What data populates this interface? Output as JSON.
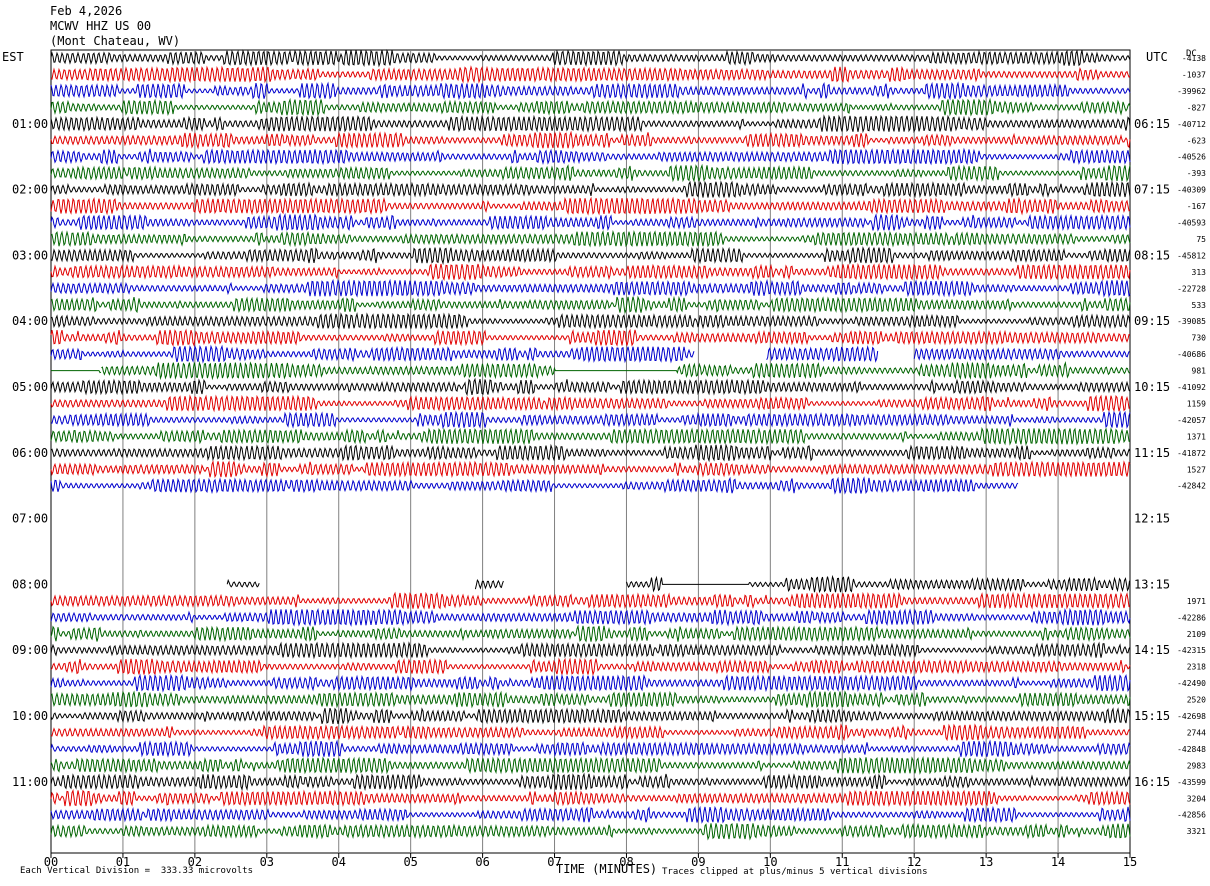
{
  "header": {
    "date": "Feb 4,2026",
    "station": "MCWV HHZ US 00",
    "location": "(Mont Chateau, WV)"
  },
  "left_axis_title": "EST",
  "right_axis_title": "UTC",
  "right_column_title": "DC",
  "footer": {
    "scale_note": "Each Vertical Division =  333.33 microvolts",
    "clip_note": "Traces clipped at plus/minus 5 vertical divisions",
    "x_axis_title": "TIME (MINUTES)"
  },
  "colors": {
    "black": "#000000",
    "red": "#e00000",
    "blue": "#0000cc",
    "green": "#006400",
    "grid": "#808080"
  },
  "chart_data": {
    "type": "line",
    "title": "MCWV HHZ US 00",
    "xlabel": "TIME (MINUTES)",
    "xlim": [
      0,
      15
    ],
    "x_ticks": [
      "00",
      "01",
      "02",
      "03",
      "04",
      "05",
      "06",
      "07",
      "08",
      "09",
      "10",
      "11",
      "12",
      "13",
      "14",
      "15"
    ],
    "grid": true,
    "trace_color_cycle": [
      "black",
      "red",
      "blue",
      "green"
    ],
    "left_hour_labels": [
      {
        "row": 4,
        "text": "01:00"
      },
      {
        "row": 8,
        "text": "02:00"
      },
      {
        "row": 12,
        "text": "03:00"
      },
      {
        "row": 16,
        "text": "04:00"
      },
      {
        "row": 20,
        "text": "05:00"
      },
      {
        "row": 24,
        "text": "06:00"
      },
      {
        "row": 28,
        "text": "07:00"
      },
      {
        "row": 32,
        "text": "08:00"
      },
      {
        "row": 36,
        "text": "09:00"
      },
      {
        "row": 40,
        "text": "10:00"
      },
      {
        "row": 44,
        "text": "11:00"
      }
    ],
    "right_hour_labels": [
      {
        "row": 4,
        "text": "06:15"
      },
      {
        "row": 8,
        "text": "07:15"
      },
      {
        "row": 12,
        "text": "08:15"
      },
      {
        "row": 16,
        "text": "09:15"
      },
      {
        "row": 20,
        "text": "10:15"
      },
      {
        "row": 24,
        "text": "11:15"
      },
      {
        "row": 28,
        "text": "12:15"
      },
      {
        "row": 32,
        "text": "13:15"
      },
      {
        "row": 36,
        "text": "14:15"
      },
      {
        "row": 40,
        "text": "15:15"
      },
      {
        "row": 44,
        "text": "16:15"
      }
    ],
    "dc_offsets": [
      {
        "row": 0,
        "text": "-4138"
      },
      {
        "row": 1,
        "text": "-1037"
      },
      {
        "row": 2,
        "text": "-39962"
      },
      {
        "row": 3,
        "text": "-827"
      },
      {
        "row": 4,
        "text": "-40712"
      },
      {
        "row": 5,
        "text": "-623"
      },
      {
        "row": 6,
        "text": "-40526"
      },
      {
        "row": 7,
        "text": "-393"
      },
      {
        "row": 8,
        "text": "-40309"
      },
      {
        "row": 9,
        "text": "-167"
      },
      {
        "row": 10,
        "text": "-40593"
      },
      {
        "row": 11,
        "text": "75"
      },
      {
        "row": 12,
        "text": "-45812"
      },
      {
        "row": 13,
        "text": "313"
      },
      {
        "row": 14,
        "text": "-22728"
      },
      {
        "row": 15,
        "text": "533"
      },
      {
        "row": 16,
        "text": "-39085"
      },
      {
        "row": 17,
        "text": "730"
      },
      {
        "row": 18,
        "text": "-40686"
      },
      {
        "row": 19,
        "text": "981"
      },
      {
        "row": 20,
        "text": "-41092"
      },
      {
        "row": 21,
        "text": "1159"
      },
      {
        "row": 22,
        "text": "-42057"
      },
      {
        "row": 23,
        "text": "1371"
      },
      {
        "row": 24,
        "text": "-41872"
      },
      {
        "row": 25,
        "text": "1527"
      },
      {
        "row": 26,
        "text": "-42842"
      },
      {
        "row": 33,
        "text": "1971"
      },
      {
        "row": 34,
        "text": "-42286"
      },
      {
        "row": 35,
        "text": "2109"
      },
      {
        "row": 36,
        "text": "-42315"
      },
      {
        "row": 37,
        "text": "2318"
      },
      {
        "row": 38,
        "text": "-42490"
      },
      {
        "row": 39,
        "text": "2520"
      },
      {
        "row": 40,
        "text": "-42698"
      },
      {
        "row": 41,
        "text": "2744"
      },
      {
        "row": 42,
        "text": "-42848"
      },
      {
        "row": 43,
        "text": "2983"
      },
      {
        "row": 44,
        "text": "-43599"
      },
      {
        "row": 45,
        "text": "3204"
      },
      {
        "row": 46,
        "text": "-42856"
      },
      {
        "row": 47,
        "text": "3321"
      }
    ],
    "row_count": 48,
    "data_rows": [
      {
        "row": 0,
        "segments": [
          [
            0,
            15
          ]
        ]
      },
      {
        "row": 1,
        "segments": [
          [
            0,
            15
          ]
        ]
      },
      {
        "row": 2,
        "segments": [
          [
            0,
            15
          ]
        ]
      },
      {
        "row": 3,
        "segments": [
          [
            0,
            15
          ]
        ]
      },
      {
        "row": 4,
        "segments": [
          [
            0,
            15
          ]
        ]
      },
      {
        "row": 5,
        "segments": [
          [
            0,
            15
          ]
        ]
      },
      {
        "row": 6,
        "segments": [
          [
            0,
            15
          ]
        ]
      },
      {
        "row": 7,
        "segments": [
          [
            0,
            15
          ]
        ]
      },
      {
        "row": 8,
        "segments": [
          [
            0,
            15
          ]
        ]
      },
      {
        "row": 9,
        "segments": [
          [
            0,
            15
          ]
        ]
      },
      {
        "row": 10,
        "segments": [
          [
            0,
            15
          ]
        ]
      },
      {
        "row": 11,
        "segments": [
          [
            0,
            15
          ]
        ]
      },
      {
        "row": 12,
        "segments": [
          [
            0,
            15
          ]
        ]
      },
      {
        "row": 13,
        "segments": [
          [
            0,
            15
          ]
        ]
      },
      {
        "row": 14,
        "segments": [
          [
            0,
            15
          ]
        ]
      },
      {
        "row": 15,
        "segments": [
          [
            0,
            15
          ]
        ]
      },
      {
        "row": 16,
        "segments": [
          [
            0,
            15
          ]
        ]
      },
      {
        "row": 17,
        "segments": [
          [
            0,
            15
          ]
        ]
      },
      {
        "row": 18,
        "segments": [
          [
            0,
            8.95
          ],
          [
            9.95,
            11.5
          ],
          [
            12.0,
            15
          ]
        ]
      },
      {
        "row": 19,
        "segments": [
          [
            0,
            0.7
          ],
          [
            0.7,
            15
          ]
        ],
        "flat": [
          [
            0,
            0.68
          ],
          [
            7.0,
            8.7
          ]
        ]
      },
      {
        "row": 20,
        "segments": [
          [
            0,
            15
          ]
        ]
      },
      {
        "row": 21,
        "segments": [
          [
            0,
            15
          ]
        ]
      },
      {
        "row": 22,
        "segments": [
          [
            0,
            15
          ]
        ]
      },
      {
        "row": 23,
        "segments": [
          [
            0,
            15
          ]
        ]
      },
      {
        "row": 24,
        "segments": [
          [
            0,
            15
          ]
        ]
      },
      {
        "row": 25,
        "segments": [
          [
            0,
            15
          ]
        ]
      },
      {
        "row": 26,
        "segments": [
          [
            0,
            13.45
          ]
        ]
      },
      {
        "row": 32,
        "segments": [
          [
            2.45,
            2.9
          ],
          [
            5.9,
            6.3
          ],
          [
            8.0,
            15
          ]
        ],
        "flat": [
          [
            8.5,
            9.7
          ]
        ]
      },
      {
        "row": 33,
        "segments": [
          [
            0,
            15
          ]
        ]
      },
      {
        "row": 34,
        "segments": [
          [
            0,
            15
          ]
        ]
      },
      {
        "row": 35,
        "segments": [
          [
            0,
            15
          ]
        ]
      },
      {
        "row": 36,
        "segments": [
          [
            0,
            15
          ]
        ]
      },
      {
        "row": 37,
        "segments": [
          [
            0,
            15
          ]
        ]
      },
      {
        "row": 38,
        "segments": [
          [
            0,
            15
          ]
        ]
      },
      {
        "row": 39,
        "segments": [
          [
            0,
            15
          ]
        ]
      },
      {
        "row": 40,
        "segments": [
          [
            0,
            15
          ]
        ]
      },
      {
        "row": 41,
        "segments": [
          [
            0,
            15
          ]
        ]
      },
      {
        "row": 42,
        "segments": [
          [
            0,
            15
          ]
        ]
      },
      {
        "row": 43,
        "segments": [
          [
            0,
            15
          ]
        ]
      },
      {
        "row": 44,
        "segments": [
          [
            0,
            15
          ]
        ]
      },
      {
        "row": 45,
        "segments": [
          [
            0,
            15
          ]
        ]
      },
      {
        "row": 46,
        "segments": [
          [
            0,
            15
          ]
        ]
      },
      {
        "row": 47,
        "segments": [
          [
            0,
            15
          ]
        ]
      }
    ]
  }
}
